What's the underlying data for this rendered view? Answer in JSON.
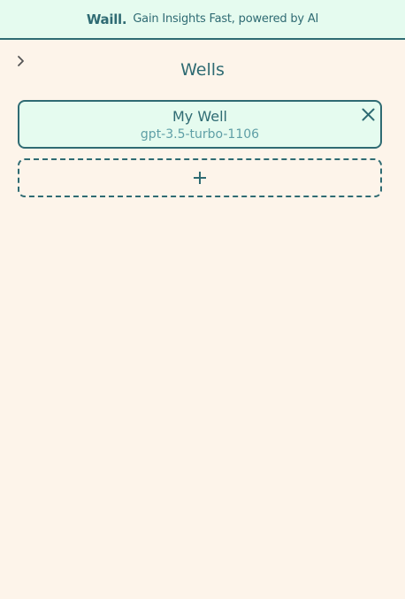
{
  "header": {
    "brand": "Waill.",
    "tagline": "Gain Insights Fast, powered by AI"
  },
  "sidebar_toggle": {
    "icon": "chevron-right-icon"
  },
  "main": {
    "title": "Wells",
    "wells": [
      {
        "name": "My Well",
        "model": "gpt-3.5-turbo-1106",
        "close_icon": "close-icon"
      }
    ],
    "add_icon": "plus-icon"
  },
  "colors": {
    "background": "#fdf4ea",
    "header_bg": "#e5fbef",
    "accent": "#2f6b73",
    "muted_accent": "#5f9fa6"
  }
}
